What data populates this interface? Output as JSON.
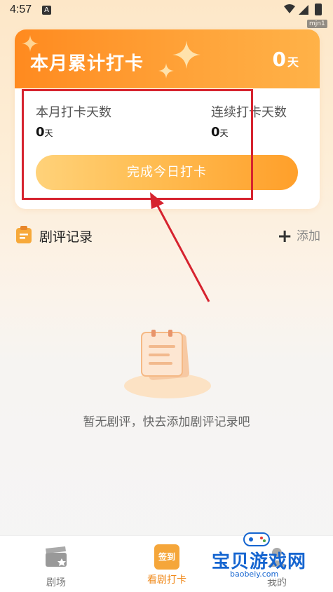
{
  "status_bar": {
    "time": "4:57",
    "app_badge": "A"
  },
  "corner_tag": "mjn1",
  "card": {
    "title": "本月累计打卡",
    "total_value": "0",
    "total_unit": "天",
    "stats": [
      {
        "label": "本月打卡天数",
        "value": "0",
        "unit": "天"
      },
      {
        "label": "连续打卡天数",
        "value": "0",
        "unit": "天"
      }
    ],
    "checkin_button": "完成今日打卡"
  },
  "section": {
    "title": "剧评记录",
    "add_label": "添加",
    "add_icon": "plus-icon"
  },
  "empty_state": {
    "text": "暂无剧评，快去添加剧评记录吧",
    "icon": "empty-note-icon"
  },
  "bottom_nav": {
    "items": [
      {
        "label": "剧场",
        "icon": "clapperboard-icon",
        "active": false
      },
      {
        "label": "看剧打卡",
        "icon": "checkin-calendar-icon",
        "badge": "签到",
        "active": true
      },
      {
        "label": "我的",
        "icon": "profile-icon",
        "active": false
      }
    ]
  },
  "watermark": {
    "text": "宝贝游戏网",
    "url": "baobeiy.com"
  },
  "colors": {
    "accent": "#ff8a1f",
    "annotation_red": "#d6232f",
    "watermark_blue": "#1565d0"
  }
}
